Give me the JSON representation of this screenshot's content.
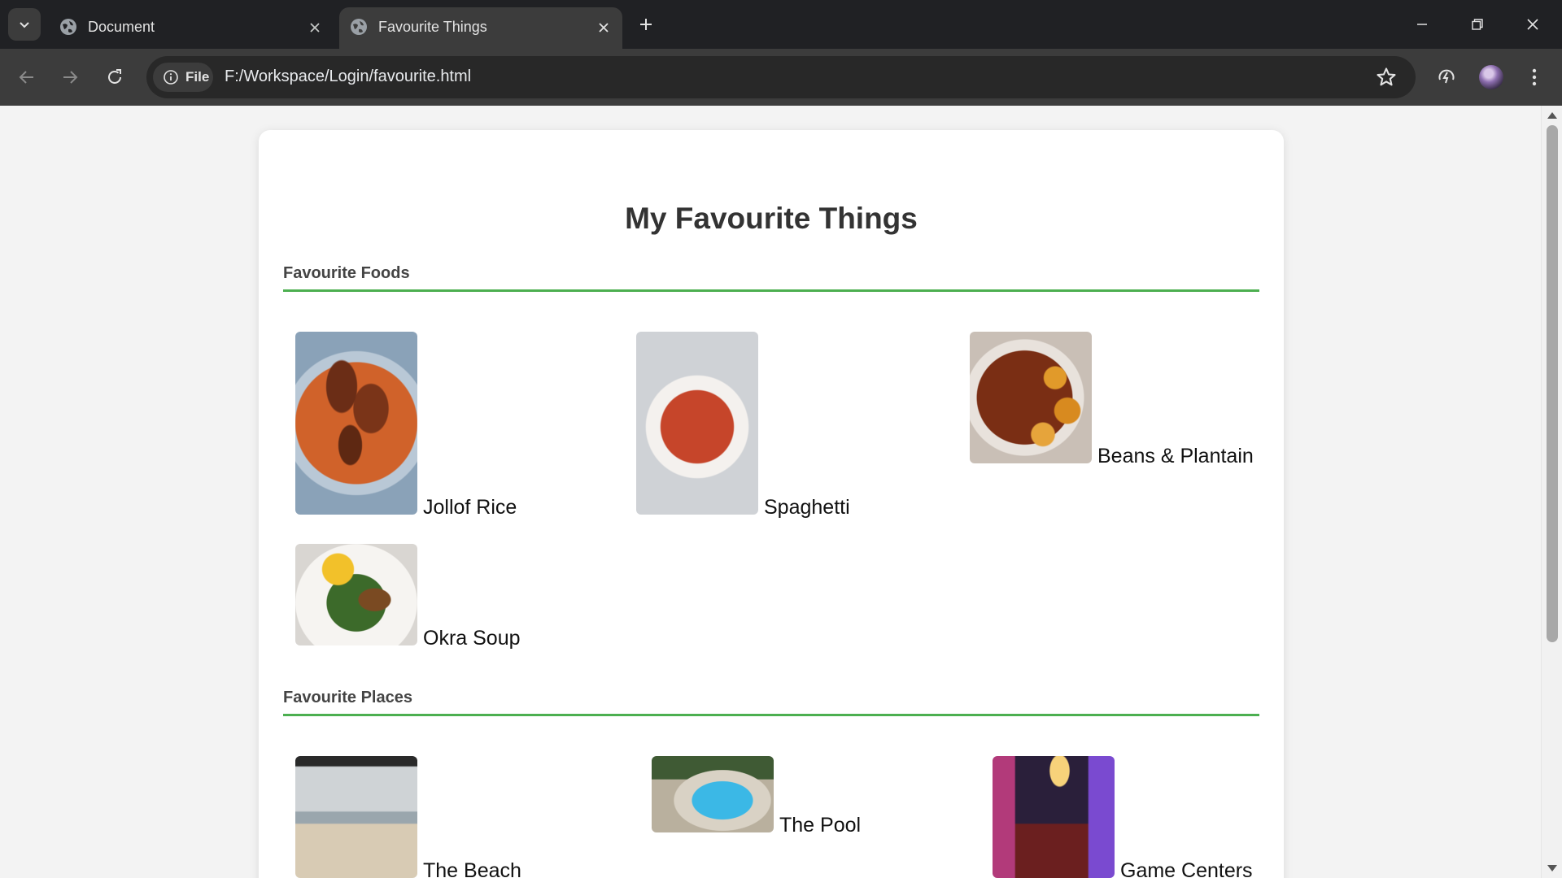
{
  "browser": {
    "tabs": [
      {
        "title": "Document",
        "active": false
      },
      {
        "title": "Favourite Things",
        "active": true
      }
    ],
    "omnibox": {
      "chip_label": "File",
      "url": "F:/Workspace/Login/favourite.html"
    },
    "icons": [
      "tab-search-icon",
      "globe-icon",
      "close-icon",
      "plus-icon",
      "minimize-icon",
      "restore-icon",
      "back-arrow-icon",
      "forward-arrow-icon",
      "reload-icon",
      "info-icon",
      "star-icon",
      "performance-icon",
      "avatar",
      "kebab-menu-icon"
    ]
  },
  "page": {
    "title": "My Favourite Things",
    "sections": [
      {
        "heading": "Favourite Foods",
        "items": [
          {
            "label": "Jollof Rice"
          },
          {
            "label": "Spaghetti"
          },
          {
            "label": "Beans & Plantain"
          },
          {
            "label": "Okra Soup"
          }
        ]
      },
      {
        "heading": "Favourite Places",
        "items": [
          {
            "label": "The Beach"
          },
          {
            "label": "The Pool"
          },
          {
            "label": "Game Centers"
          }
        ]
      }
    ],
    "accent_color": "#4caf50"
  }
}
